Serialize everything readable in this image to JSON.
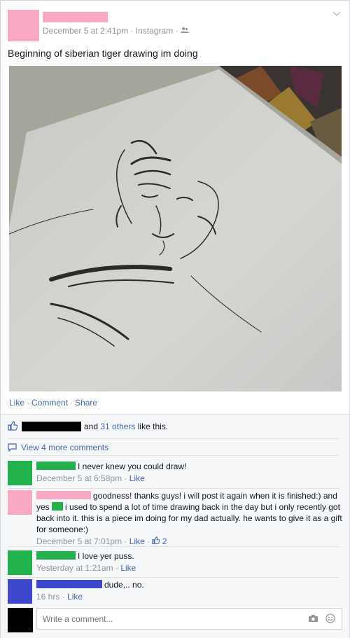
{
  "post": {
    "timestamp": "December 5 at 2:41pm",
    "via": "Instagram",
    "caption": "Beginning of siberian tiger drawing im doing",
    "colors": {
      "author": "#f9a8c4"
    }
  },
  "actions": {
    "like": "Like",
    "comment": "Comment",
    "share": "Share"
  },
  "likes": {
    "and_text": "and",
    "others_link": "31 others",
    "suffix": "like this."
  },
  "more_comments": "View 4 more comments",
  "comments": [
    {
      "avatar_color": "#22b14c",
      "text": "I never knew you could draw!",
      "time": "December 5 at 6:58pm",
      "like": "Like"
    },
    {
      "avatar_color": "#f9a8c4",
      "text_a": "goodness! thanks guys! i will post it again when it is finished:)",
      "text_b": "and yes",
      "text_c": "i used to spend a lot of time drawing back in the day but i only recently got back into it. this is a piece im doing for my dad actually. he wants to give it as a gift for someone:)",
      "time": "December 5 at 7:01pm",
      "like": "Like",
      "like_count": "2"
    },
    {
      "avatar_color": "#22b14c",
      "text": "I love yer puss.",
      "time": "Yesterday at 1:21am",
      "like": "Like"
    },
    {
      "avatar_color": "#3f48cc",
      "text": "dude,.. no.",
      "time": "16 hrs",
      "like": "Like"
    }
  ],
  "composer": {
    "placeholder": "Write a comment..."
  }
}
